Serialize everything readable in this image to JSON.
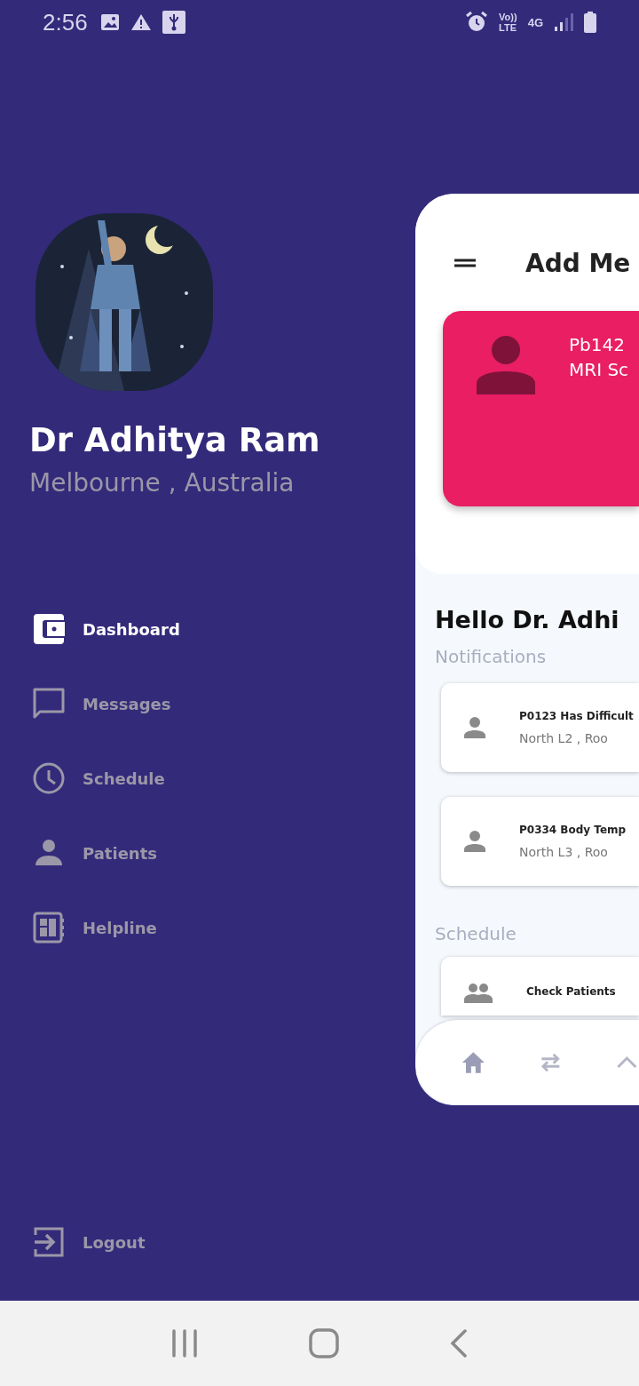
{
  "status_bar": {
    "time": "2:56",
    "volte_top": "Vo))",
    "volte_bottom": "LTE",
    "network": "4G"
  },
  "profile": {
    "name": "Dr Adhitya Ram",
    "location": "Melbourne , Australia"
  },
  "menu": [
    {
      "label": "Dashboard",
      "kind": "dashboard",
      "selected": true
    },
    {
      "label": "Messages",
      "kind": "messages",
      "selected": false
    },
    {
      "label": "Schedule",
      "kind": "schedule",
      "selected": false
    },
    {
      "label": "Patients",
      "kind": "patients",
      "selected": false
    },
    {
      "label": "Helpline",
      "kind": "helpline",
      "selected": false
    }
  ],
  "logout": {
    "label": "Logout"
  },
  "app_preview": {
    "title": "Add Me",
    "patient_card": {
      "id": "Pb142",
      "test": "MRI Sc",
      "color": "#e91e63"
    },
    "greeting": "Hello Dr. Adhi",
    "notifications_heading": "Notifications",
    "notifications": [
      {
        "title": "P0123 Has Difficult",
        "location": "North L2 , Roo"
      },
      {
        "title": "P0334 Body Temp",
        "location": "North L3 , Roo"
      }
    ],
    "schedule_heading": "Schedule",
    "schedule": [
      {
        "title": "Check Patients"
      }
    ],
    "bottom_nav": [
      {
        "kind": "home",
        "selected": true
      },
      {
        "kind": "swap",
        "selected": false
      },
      {
        "kind": "up",
        "selected": false
      }
    ]
  }
}
